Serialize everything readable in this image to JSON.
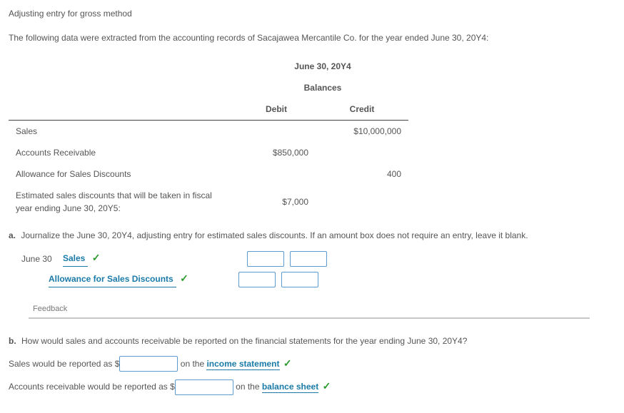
{
  "title": "Adjusting entry for gross method",
  "intro": "The following data were extracted from the accounting records of Sacajawea Mercantile Co. for the year ended June 30, 20Y4:",
  "balances": {
    "header1": "June 30, 20Y4",
    "header2": "Balances",
    "col_debit": "Debit",
    "col_credit": "Credit",
    "rows": [
      {
        "label": "Sales",
        "debit": "",
        "credit": "$10,000,000"
      },
      {
        "label": "Accounts Receivable",
        "debit": "$850,000",
        "credit": ""
      },
      {
        "label": "Allowance for Sales Discounts",
        "debit": "",
        "credit": "400"
      },
      {
        "label": "Estimated sales discounts that will be taken in fiscal year ending June 30, 20Y5:",
        "debit": "$7,000",
        "credit": ""
      }
    ]
  },
  "part_a": {
    "label": "a.",
    "text": "Journalize the June 30, 20Y4, adjusting entry for estimated sales discounts. If an amount box does not require an entry, leave it blank.",
    "date": "June 30",
    "line1_account": "Sales",
    "line2_account": "Allowance for Sales Discounts"
  },
  "feedback_label": "Feedback",
  "part_b": {
    "label": "b.",
    "text": "How would sales and accounts receivable be reported on the financial statements for the year ending June 30, 20Y4?",
    "line1_pre": "Sales would be reported as $",
    "line1_mid": " on the ",
    "line1_link": "income statement",
    "line2_pre": "Accounts receivable would be reported as $",
    "line2_mid": " on the ",
    "line2_link": "balance sheet"
  }
}
